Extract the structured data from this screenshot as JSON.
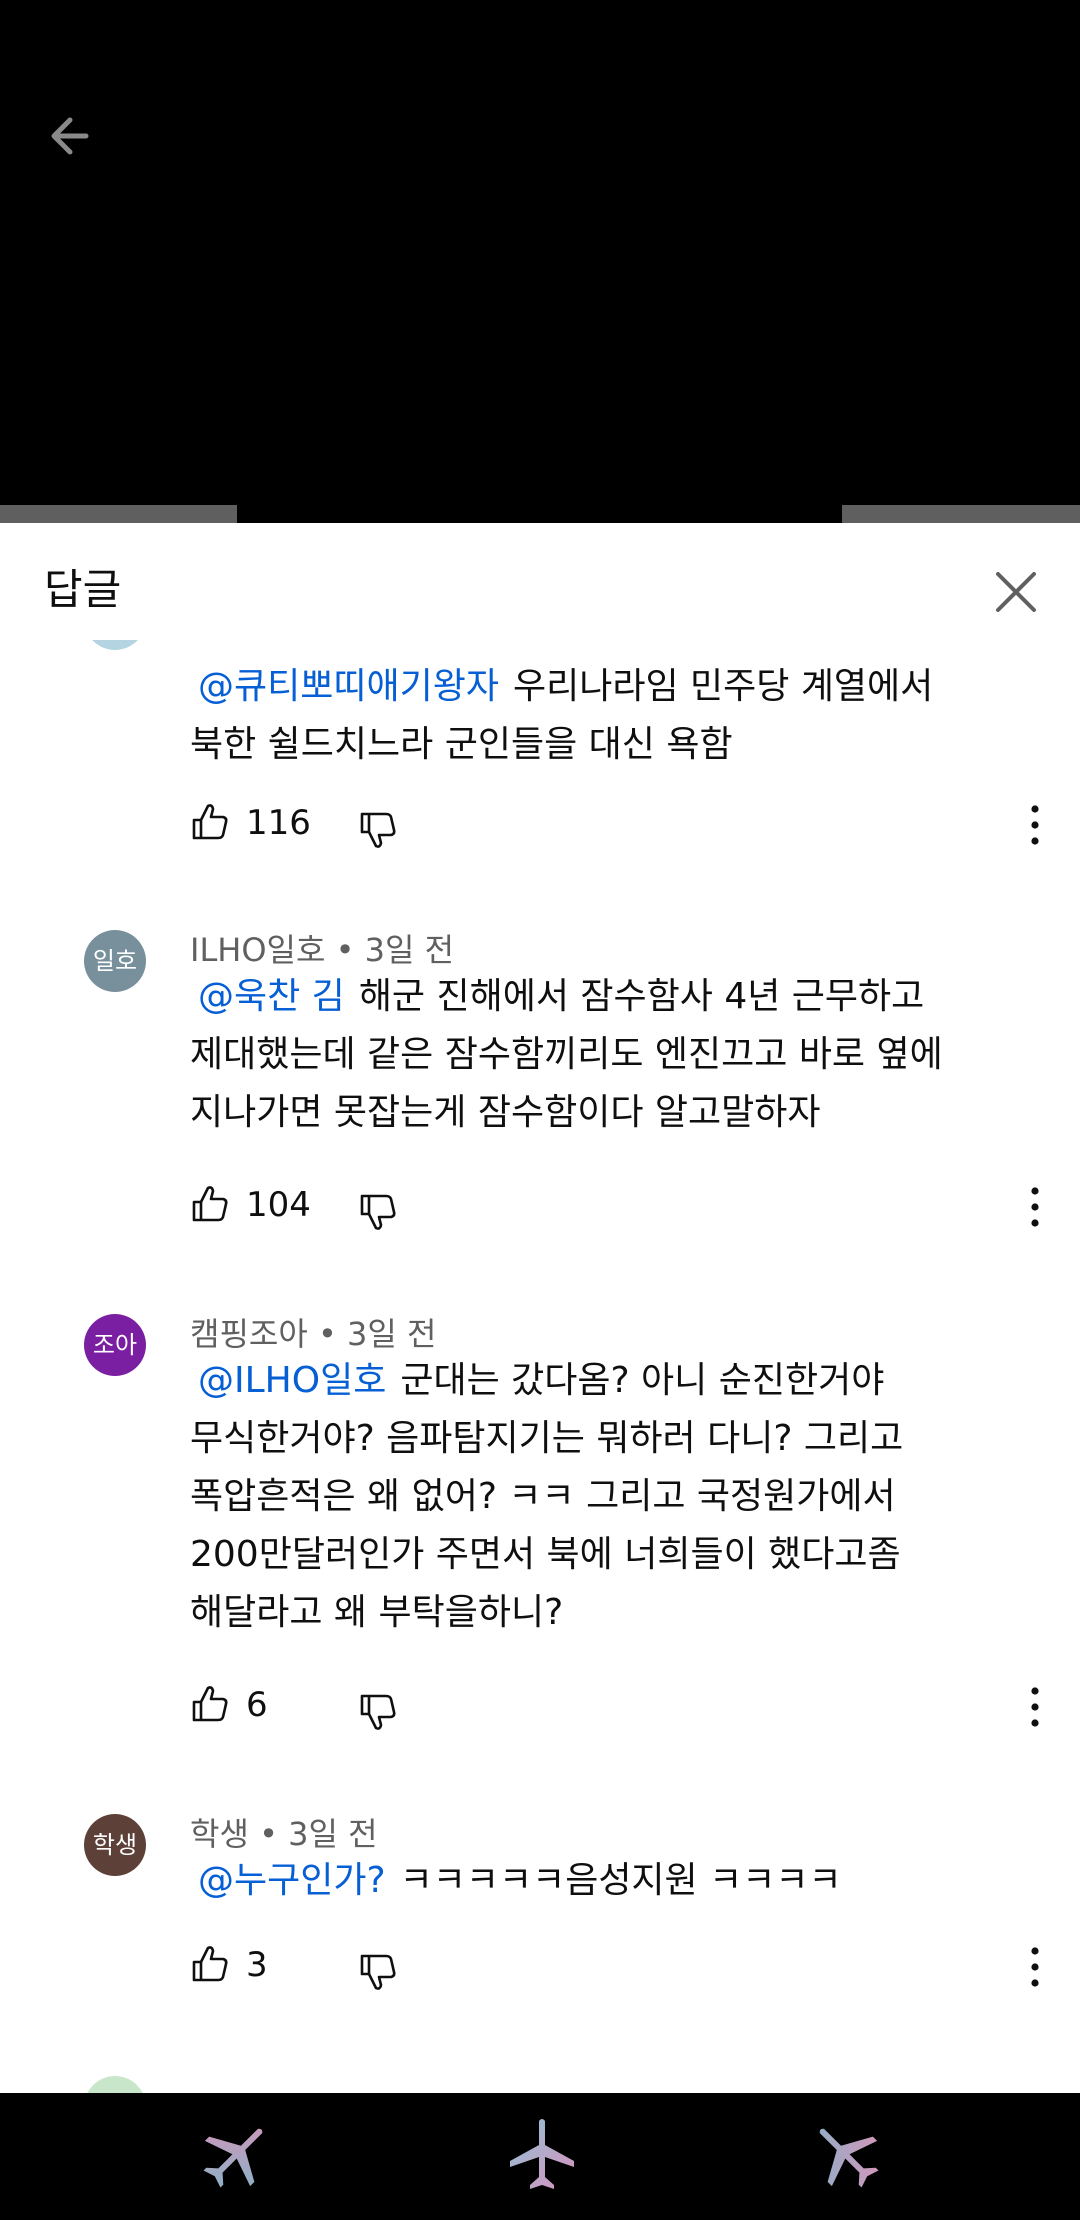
{
  "panel": {
    "title": "답글"
  },
  "comments": [
    {
      "author": "",
      "time": "",
      "mention": "@큐티뽀띠애기왕자",
      "text_line1": "우리나라임 민주당 계열에서",
      "text_line2": "북한 쉴드치느라 군인들을 대신 욕함",
      "likes": "116"
    },
    {
      "avatar_text": "일호",
      "avatar_color": "#78909c",
      "author": "ILHO일호",
      "time": "3일 전",
      "mention": "@욱찬 김",
      "text_line1": "해군 진해에서 잠수함사 4년 근무하고",
      "text_line2": "제대했는데 같은 잠수함끼리도 엔진끄고 바로 옆에",
      "text_line3": "지나가면 못잡는게 잠수함이다 알고말하자",
      "likes": "104"
    },
    {
      "avatar_text": "조아",
      "avatar_color": "#7b1fa2",
      "author": "캠핑조아",
      "time": "3일 전",
      "mention": "@ILHO일호",
      "text_line1": "군대는 갔다옴?  아니 순진한거야",
      "text_line2": "무식한거야? 음파탐지기는 뭐하러 다니? 그리고",
      "text_line3": "폭압흔적은 왜 없어? ㅋㅋ 그리고 국정원가에서",
      "text_line4": "200만달러인가 주면서 북에 너희들이 했다고좀",
      "text_line5": "해달라고 왜 부탁을하니?",
      "likes": "6"
    },
    {
      "avatar_text": "학생",
      "avatar_color": "#5d4037",
      "author": "학생",
      "time": "3일 전",
      "mention": "@누구인가?",
      "text_line1": "ㅋㅋㅋㅋㅋ음성지원 ㅋㅋㅋㅋ",
      "likes": "3"
    }
  ],
  "separator": "•",
  "colors": {
    "accent": "#065fd4",
    "text": "#0f0f0f",
    "meta": "#606060"
  },
  "bottom_nav": [
    "airplane-pink-icon",
    "airplane-blue-icon",
    "airplane-gradient-icon"
  ]
}
